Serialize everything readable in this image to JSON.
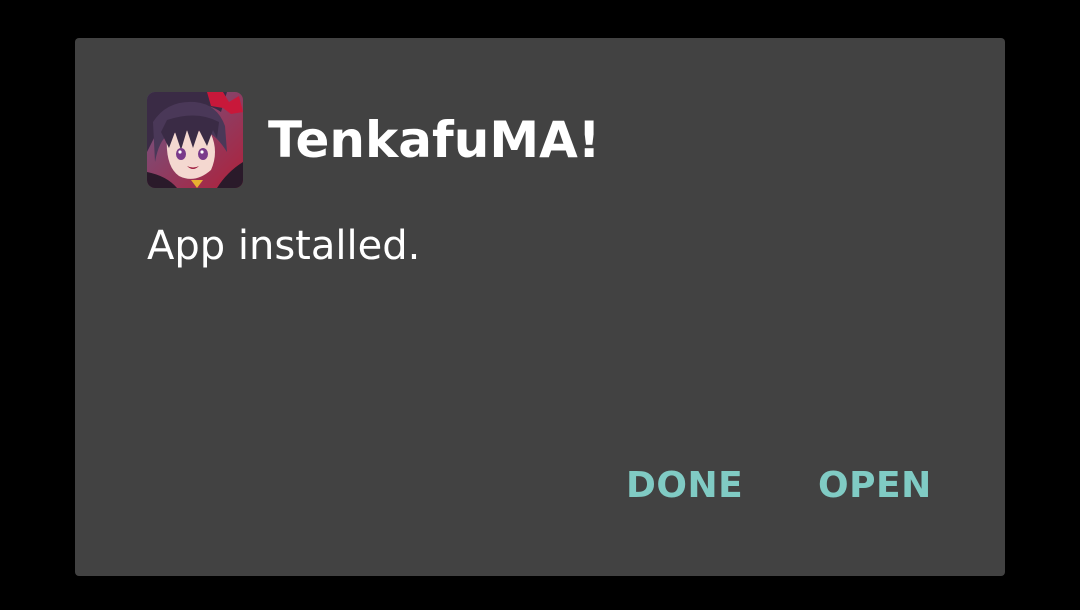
{
  "dialog": {
    "app_name": "TenkafuMA!",
    "message": "App installed.",
    "app_icon": "anime-character-app-icon"
  },
  "actions": {
    "done_label": "DONE",
    "open_label": "OPEN"
  },
  "colors": {
    "screen_background": "#000000",
    "dialog_background": "#424242",
    "text_primary": "#ffffff",
    "button_accent": "#80cbc4"
  }
}
